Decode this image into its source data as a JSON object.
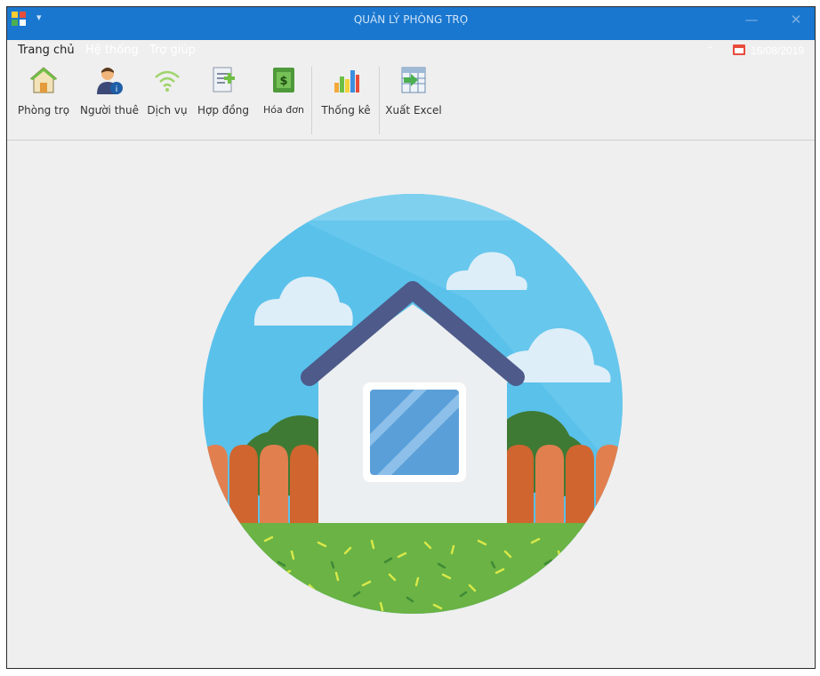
{
  "window": {
    "title": "QUẢN LÝ PHÒNG TRỌ",
    "qa_arrow": "▾",
    "minimize": "—",
    "close": "✕"
  },
  "menu": [
    {
      "label": "Trang chủ",
      "active": true
    },
    {
      "label": "Hệ thống",
      "active": false
    },
    {
      "label": "Trợ giúp",
      "active": false
    }
  ],
  "status": {
    "collapse": "⌃",
    "date": "16/08/2019"
  },
  "ribbon": [
    {
      "label": "Phòng trọ",
      "icon": "house-icon"
    },
    {
      "label": "Người thuê",
      "icon": "tenant-icon"
    },
    {
      "label": "Dịch vụ",
      "icon": "wifi-icon"
    },
    {
      "label": "Hợp đồng",
      "icon": "contract-icon"
    },
    {
      "label": "Hóa đơn",
      "icon": "invoice-icon"
    },
    {
      "label": "Thống kê",
      "icon": "chart-icon"
    },
    {
      "label": "Xuất Excel",
      "icon": "excel-icon"
    }
  ],
  "colors": {
    "titlebar": "#1977cf",
    "background": "#efefef",
    "sky": "#5ac1ea",
    "roof": "#4d5a8a",
    "grass": "#6ab344",
    "fence": "#e27f4f"
  }
}
